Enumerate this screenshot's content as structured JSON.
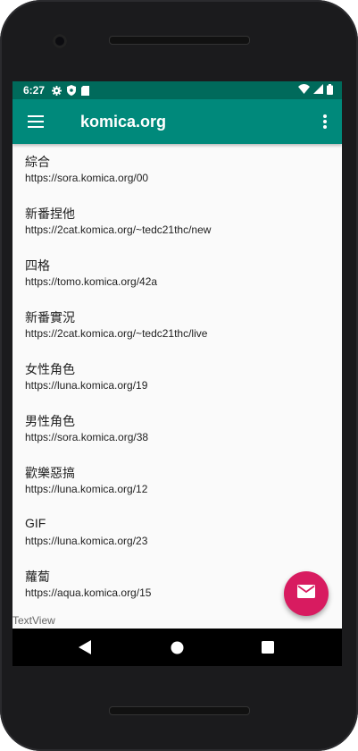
{
  "status_bar": {
    "time": "6:27",
    "left_icons": [
      "gear-icon",
      "shield-icon",
      "sd-card-icon"
    ],
    "right_icons": [
      "wifi-icon",
      "signal-icon",
      "battery-icon"
    ]
  },
  "app_bar": {
    "title": "komica.org",
    "color": "#00897b",
    "status_color": "#006a5b"
  },
  "boards": [
    {
      "name": "綜合",
      "url": "https://sora.komica.org/00"
    },
    {
      "name": "新番捏他",
      "url": "https://2cat.komica.org/~tedc21thc/new"
    },
    {
      "name": "四格",
      "url": "https://tomo.komica.org/42a"
    },
    {
      "name": "新番實況",
      "url": "https://2cat.komica.org/~tedc21thc/live"
    },
    {
      "name": "女性角色",
      "url": "https://luna.komica.org/19"
    },
    {
      "name": "男性角色",
      "url": "https://sora.komica.org/38"
    },
    {
      "name": "歡樂惡搞",
      "url": "https://luna.komica.org/12"
    },
    {
      "name": "GIF",
      "url": "https://luna.komica.org/23"
    },
    {
      "name": "蘿蔔",
      "url": "https://aqua.komica.org/15"
    }
  ],
  "footer_text": "TextView",
  "fab": {
    "icon": "mail-icon",
    "color": "#d81b60"
  },
  "nav": {
    "icons": [
      "back-icon",
      "home-icon",
      "recents-icon"
    ]
  }
}
